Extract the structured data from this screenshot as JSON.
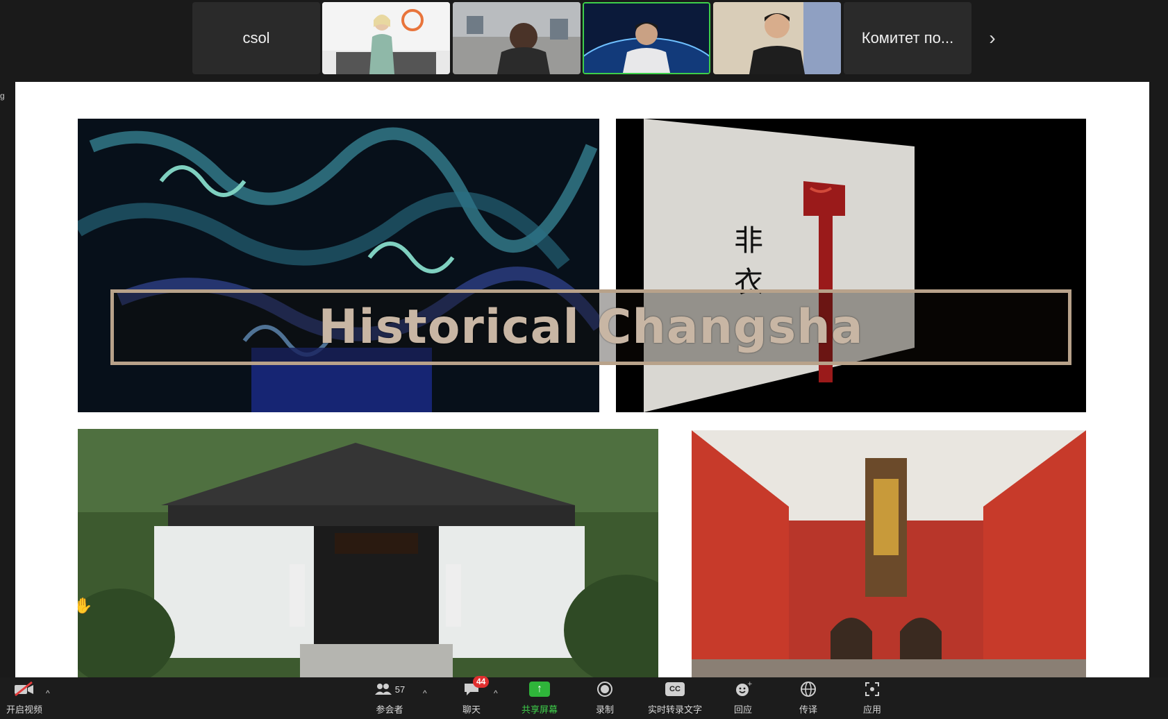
{
  "participants": {
    "tiles": [
      {
        "name": "csol",
        "type": "name"
      },
      {
        "name": "",
        "type": "video"
      },
      {
        "name": "",
        "type": "video"
      },
      {
        "name": "",
        "type": "video",
        "active": true
      },
      {
        "name": "",
        "type": "video"
      },
      {
        "name": "Комитет по...",
        "type": "name"
      }
    ],
    "next_icon": "chevron-right-icon",
    "active_color": "#3ecf4a"
  },
  "edge_mark": "g",
  "slide": {
    "title": "Historical Changsha",
    "title_color": "#c8b6a4",
    "frame_color": "#b8a28a"
  },
  "toolbar": {
    "video": {
      "label": "开启视频",
      "icon": "video-off-icon"
    },
    "participants": {
      "label": "参会者",
      "count": "57",
      "icon": "participants-icon"
    },
    "chat": {
      "label": "聊天",
      "badge": "44",
      "icon": "chat-icon"
    },
    "share": {
      "label": "共享屏幕",
      "icon": "share-screen-icon",
      "color": "#3ecf4a"
    },
    "record": {
      "label": "录制",
      "icon": "record-icon"
    },
    "transcript": {
      "label": "实时转录文字",
      "icon_text": "CC",
      "icon": "cc-icon"
    },
    "reactions": {
      "label": "回应",
      "icon": "reaction-icon"
    },
    "interpretation": {
      "label": "传译",
      "icon": "globe-icon"
    },
    "apps": {
      "label": "应用",
      "icon": "apps-icon"
    }
  }
}
